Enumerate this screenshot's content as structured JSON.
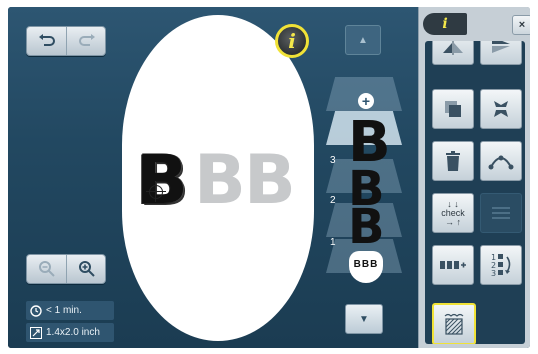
{
  "toolbar": {
    "undo_icon": "undo-icon",
    "redo_icon": "redo-icon",
    "zoom_out_icon": "zoom-out-icon",
    "zoom_in_icon": "zoom-in-icon",
    "info_label": "i"
  },
  "design": {
    "letters": [
      "B",
      "B",
      "B"
    ]
  },
  "status": {
    "time": "< 1 min.",
    "size": "1.4x2.0 inch"
  },
  "layers": {
    "numbers": [
      "3",
      "2",
      "1"
    ],
    "layer_letters": [
      "B",
      "B",
      "B"
    ],
    "thumbnail_text": "BBB",
    "add_symbol": "+"
  },
  "panel": {
    "info_tab_label": "i",
    "close_label": "×",
    "check_label": "check",
    "sequence_digits": [
      "1",
      "2",
      "3"
    ]
  },
  "colors": {
    "accent": "#f0e237",
    "screen_bg": "#224861",
    "panel_bg": "#c6cfd6"
  }
}
